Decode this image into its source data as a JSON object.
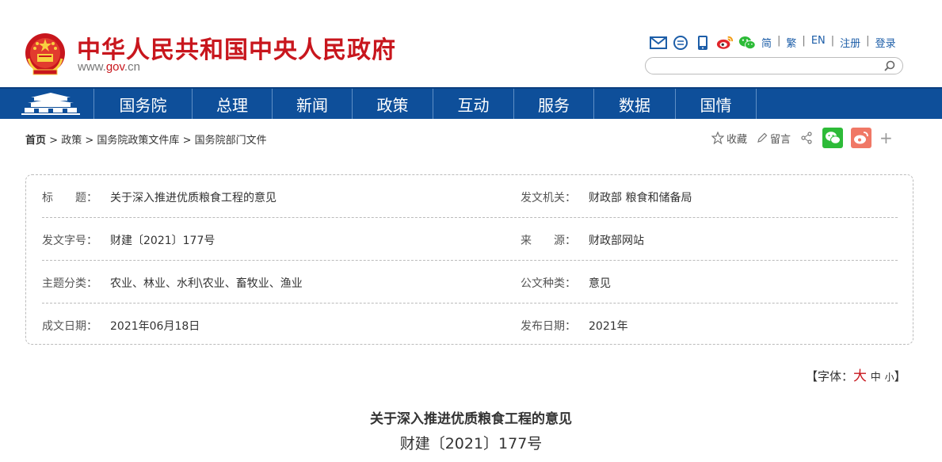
{
  "header": {
    "site_title": "中华人民共和国中央人民政府",
    "url_pre": "www.",
    "url_gov": "gov",
    "url_post": ".cn",
    "icons": [
      "mail-icon",
      "message-icon",
      "mobile-icon",
      "weibo-icon",
      "wechat-icon"
    ],
    "lang_links": [
      "简",
      "繁",
      "EN",
      "注册",
      "登录"
    ],
    "lang_sep": "|",
    "search": {
      "placeholder": ""
    }
  },
  "nav": {
    "items": [
      "国务院",
      "总理",
      "新闻",
      "政策",
      "互动",
      "服务",
      "数据",
      "国情"
    ]
  },
  "breadcrumb": {
    "home": "首页",
    "sep": ">",
    "items": [
      "政策",
      "国务院政策文件库",
      "国务院部门文件"
    ]
  },
  "tools": {
    "favorite": "收藏",
    "comment": "留言",
    "plus": "+"
  },
  "info_table": {
    "rows": [
      {
        "l_label": "标　　题：",
        "l_value": "关于深入推进优质粮食工程的意见",
        "r_label": "发文机关：",
        "r_value": "财政部 粮食和储备局"
      },
      {
        "l_label": "发文字号：",
        "l_value": "财建〔2021〕177号",
        "r_label": "来　　源：",
        "r_value": "财政部网站"
      },
      {
        "l_label": "主题分类：",
        "l_value": "农业、林业、水利\\农业、畜牧业、渔业",
        "r_label": "公文种类：",
        "r_value": "意见"
      },
      {
        "l_label": "成文日期：",
        "l_value": "2021年06月18日",
        "r_label": "发布日期：",
        "r_value": "2021年"
      }
    ]
  },
  "font_size": {
    "prefix": "【字体：",
    "large": "大",
    "medium": "中",
    "small": "小",
    "suffix": "】"
  },
  "document": {
    "title": "关于深入推进优质粮食工程的意见",
    "number": "财建〔2021〕177号"
  },
  "colors": {
    "brand_red": "#c8161d",
    "nav_blue": "#0e4f9a",
    "link_blue": "#1d5ea8"
  }
}
